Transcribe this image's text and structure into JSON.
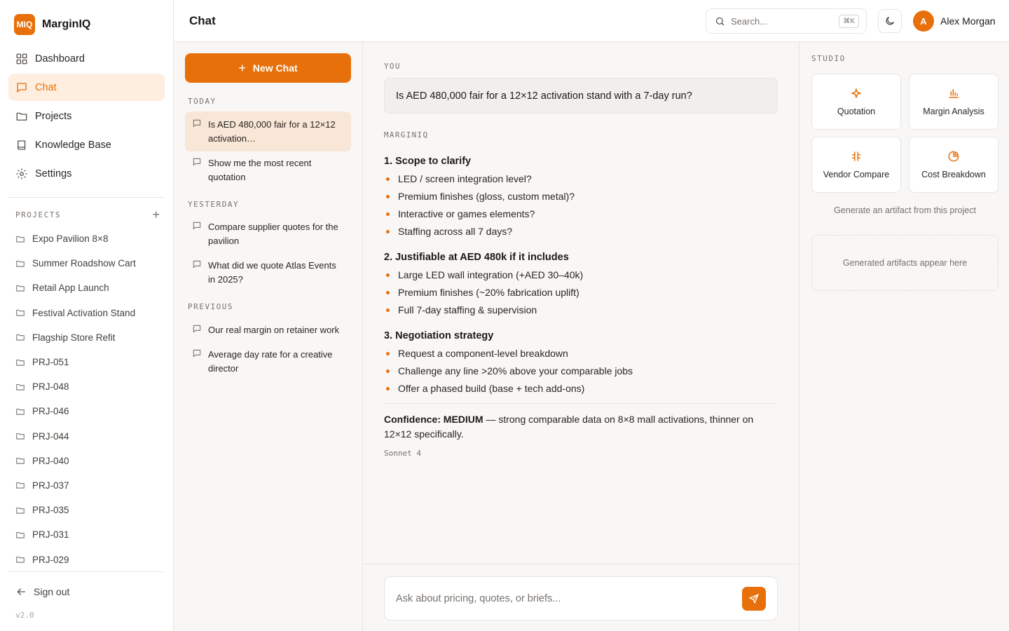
{
  "app": {
    "logo": "MIQ",
    "name": "MarginIQ",
    "version": "v2.0"
  },
  "colors": {
    "accent": "#e8700a",
    "accent_soft": "#fdeee0",
    "background": "#f8f7f5",
    "border": "#e7e5e4"
  },
  "nav": [
    {
      "label": "Dashboard",
      "icon": "grid-icon",
      "active": false
    },
    {
      "label": "Chat",
      "icon": "chat-icon",
      "active": true
    },
    {
      "label": "Projects",
      "icon": "folder-icon",
      "active": false
    },
    {
      "label": "Knowledge Base",
      "icon": "book-icon",
      "active": false
    },
    {
      "label": "Settings",
      "icon": "gear-icon",
      "active": false
    }
  ],
  "projects": {
    "label": "PROJECTS",
    "add": "+",
    "items": [
      "Expo Pavilion 8×8",
      "Summer Roadshow Cart",
      "Retail App Launch",
      "Festival Activation Stand",
      "Flagship Store Refit",
      "PRJ-051",
      "PRJ-048",
      "PRJ-046",
      "PRJ-044",
      "PRJ-040",
      "PRJ-037",
      "PRJ-035",
      "PRJ-031",
      "PRJ-029"
    ]
  },
  "signout": "Sign out",
  "header": {
    "title": "Chat",
    "search_placeholder": "Search...",
    "search_shortcut": "⌘K",
    "user_initial": "A",
    "user_name": "Alex Morgan"
  },
  "history": {
    "new_chat": "New Chat",
    "new_chat_plus": "+",
    "groups": [
      {
        "label": "TODAY",
        "items": [
          {
            "text": "Is AED 480,000 fair for a 12×12 activation…",
            "active": true
          },
          {
            "text": "Show me the most recent quotation",
            "active": false
          }
        ]
      },
      {
        "label": "YESTERDAY",
        "items": [
          {
            "text": "Compare supplier quotes for the pavilion",
            "active": false
          },
          {
            "text": "What did we quote Atlas Events in 2025?",
            "active": false
          }
        ]
      },
      {
        "label": "PREVIOUS",
        "items": [
          {
            "text": "Our real margin on retainer work",
            "active": false
          },
          {
            "text": "Average day rate for a creative director",
            "active": false
          }
        ]
      }
    ]
  },
  "chat": {
    "user_role": "YOU",
    "user_message": "Is AED 480,000 fair for a 12×12 activation stand with a 7-day run?",
    "assistant_role": "MARGINIQ",
    "sections": [
      {
        "title": "1. Scope to clarify",
        "bullets": [
          "LED / screen integration level?",
          "Premium finishes (gloss, custom metal)?",
          "Interactive or games elements?",
          "Staffing across all 7 days?"
        ]
      },
      {
        "title": "2. Justifiable at AED 480k if it includes",
        "bullets": [
          "Large LED wall integration (+AED 30–40k)",
          "Premium finishes (~20% fabrication uplift)",
          "Full 7-day staffing & supervision"
        ]
      },
      {
        "title": "3. Negotiation strategy",
        "bullets": [
          "Request a component-level breakdown",
          "Challenge any line >20% above your comparable jobs",
          "Offer a phased build (base + tech add-ons)"
        ]
      }
    ],
    "confidence_label": "Confidence: MEDIUM",
    "confidence_text": " — strong comparable data on 8×8 mall activations, thinner on 12×12 specifically.",
    "model": "Sonnet 4",
    "composer_placeholder": "Ask about pricing, quotes, or briefs..."
  },
  "studio": {
    "label": "STUDIO",
    "tiles": [
      {
        "label": "Quotation",
        "icon": "sparkle-icon"
      },
      {
        "label": "Margin Analysis",
        "icon": "bar-chart-icon"
      },
      {
        "label": "Vendor Compare",
        "icon": "compare-icon"
      },
      {
        "label": "Cost Breakdown",
        "icon": "pie-chart-icon"
      }
    ],
    "hint": "Generate an artifact from this project",
    "artifacts_empty": "Generated artifacts appear here"
  }
}
